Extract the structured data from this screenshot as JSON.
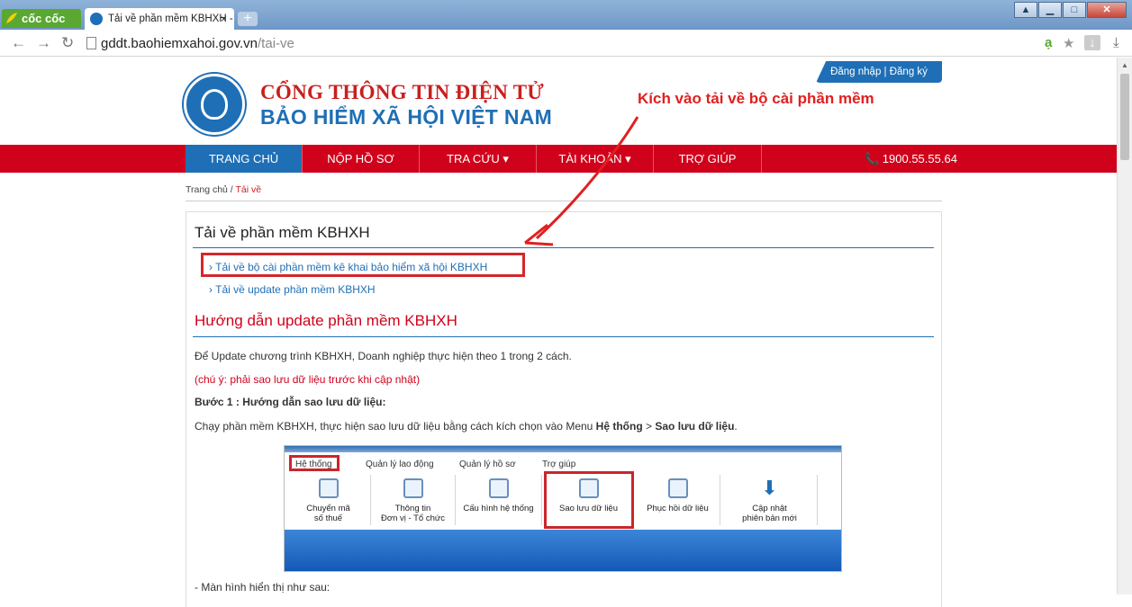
{
  "browser": {
    "brand": "cốc cốc",
    "tab_title": "Tải về phần mềm KBHXH -",
    "tab_close": "×",
    "new_tab": "+",
    "url_host": "gddt.baohiemxahoi.gov.vn",
    "url_path": "/tai-ve",
    "win_min": "▁",
    "win_max": "□",
    "win_close": "✕"
  },
  "header": {
    "auth": "Đăng nhập  |  Đăng ký",
    "title_line1": "CỔNG THÔNG TIN ĐIỆN TỬ",
    "title_line2": "BẢO HIỂM XÃ HỘI VIỆT NAM",
    "annotation": "Kích vào tải về bộ cài phần mềm"
  },
  "menu": {
    "items": [
      "TRANG CHỦ",
      "NỘP HỒ SƠ",
      "TRA CỨU ▾",
      "TÀI KHOẢN ▾",
      "TRỢ GIÚP"
    ],
    "phone": "📞 1900.55.55.64"
  },
  "breadcrumb": {
    "home": "Trang chủ",
    "sep": " / ",
    "current": "Tải về"
  },
  "content": {
    "heading1": "Tải về phần mềm KBHXH",
    "links": [
      "› Tải về bộ cài phần mềm kê khai bảo hiểm xã hội KBHXH",
      "› Tải về update phần mềm KBHXH"
    ],
    "heading2": "Hướng dẫn update phần mềm KBHXH",
    "p1": "Để Update chương trình KBHXH, Doanh nghiệp thực hiện theo 1 trong 2 cách.",
    "p2": "(chú ý: phải sao lưu dữ liệu trước khi cập nhật)",
    "p3": "Bước 1 : Hướng dẫn sao lưu dữ liệu:",
    "p4_a": "Chạy phần mềm KBHXH, thực hiện sao lưu dữ liệu bằng cách kích chọn vào Menu ",
    "p4_b": "Hệ thống",
    "p4_c": " > ",
    "p4_d": "Sao lưu dữ liệu",
    "p4_e": ".",
    "p5": "- Màn hình hiển thị như sau:"
  },
  "app_shot": {
    "menus": [
      "Hệ thống",
      "Quản lý lao động",
      "Quản lý hồ sơ",
      "Trợ giúp"
    ],
    "buttons": [
      {
        "l1": "Chuyển mã",
        "l2": "số thuế"
      },
      {
        "l1": "Thông tin",
        "l2": "Đơn vị - Tổ chức"
      },
      {
        "l1": "Cấu hình hệ thống",
        "l2": ""
      },
      {
        "l1": "Sao lưu dữ liệu",
        "l2": ""
      },
      {
        "l1": "Phục hồi dữ liệu",
        "l2": ""
      },
      {
        "l1": "Cập nhật",
        "l2": "phiên bản mới"
      }
    ]
  },
  "colors": {
    "brand_blue": "#1f6fb6",
    "menu_red": "#d0021b",
    "annotation_red": "#e02020"
  }
}
